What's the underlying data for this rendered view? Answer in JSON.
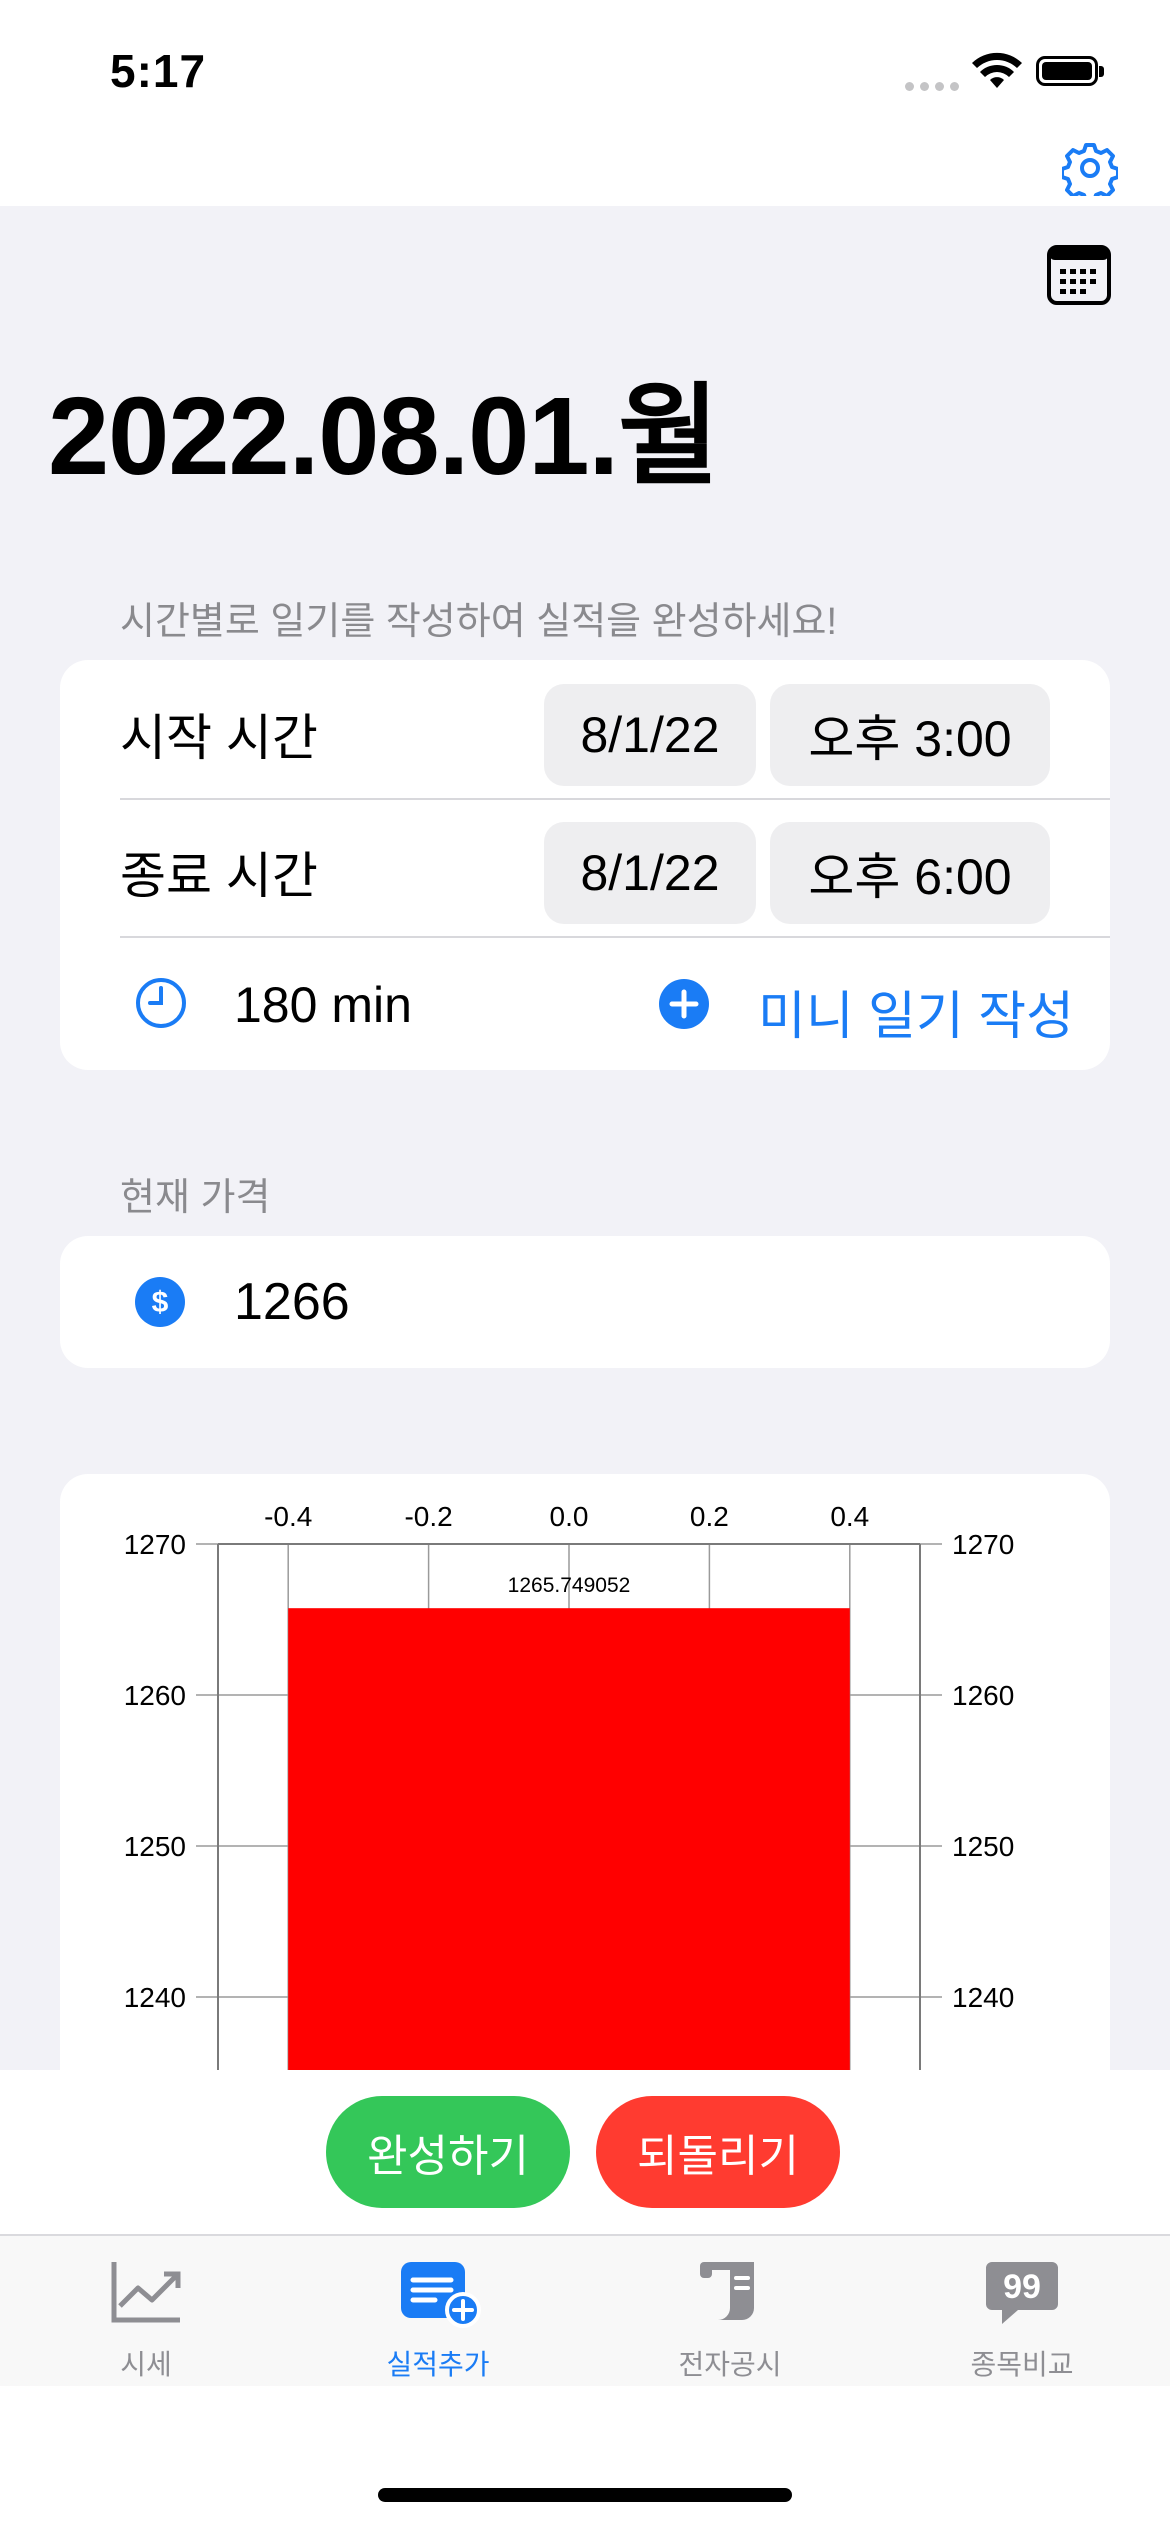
{
  "status_bar": {
    "time": "5:17"
  },
  "header": {
    "date_title": "2022.08.01.월"
  },
  "diary": {
    "hint": "시간별로 일기를 작성하여 실적을 완성하세요!",
    "start_label": "시작 시간",
    "start_date": "8/1/22",
    "start_time": "오후 3:00",
    "end_label": "종료 시간",
    "end_date": "8/1/22",
    "end_time": "오후 6:00",
    "duration": "180 min",
    "mini_diary_button": "미니 일기 작성"
  },
  "price": {
    "label": "현재 가격",
    "value": "1266"
  },
  "chart_data": {
    "type": "bar",
    "categories": [
      "0.0"
    ],
    "values": [
      1265.749052
    ],
    "data_label": "1265.749052",
    "bar_x_range": [
      -0.4,
      0.4
    ],
    "x_ticks": [
      "-0.4",
      "-0.2",
      "0.0",
      "0.2",
      "0.4"
    ],
    "y_ticks": [
      "1270",
      "1260",
      "1250",
      "1240"
    ],
    "ylim": [
      1230,
      1270
    ],
    "visible_y_min": 1235,
    "bar_color": "#ff0000",
    "grid": true
  },
  "actions": {
    "complete": "완성하기",
    "revert": "되돌리기"
  },
  "colors": {
    "accent": "#1a7cf5",
    "complete": "#34c759",
    "revert": "#ff3b30"
  },
  "tabs": [
    {
      "label": "시세",
      "icon": "chart-line-icon",
      "active": false
    },
    {
      "label": "실적추가",
      "icon": "note-add-icon",
      "active": true
    },
    {
      "label": "전자공시",
      "icon": "scroll-icon",
      "active": false
    },
    {
      "label": "종목비교",
      "icon": "quote-bubble-icon",
      "active": false
    }
  ]
}
